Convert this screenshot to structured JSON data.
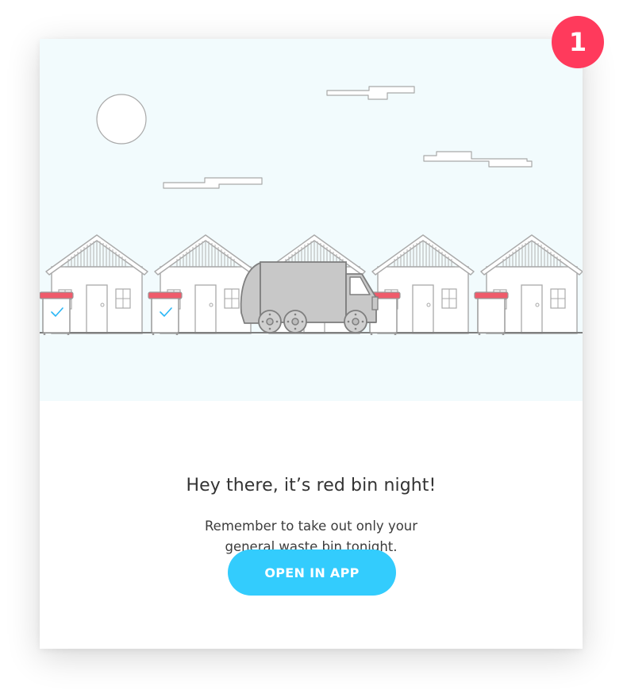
{
  "badge": {
    "count": "1"
  },
  "notification": {
    "headline": "Hey there, it’s red bin night!",
    "body_line_1": "Remember to take out only your",
    "body_line_2": "general waste bin tonight.",
    "button_label": "OPEN IN APP"
  },
  "colors": {
    "accent": "#33ccfd",
    "badge": "#ff3a5c",
    "bin_lid": "#ef5b6b",
    "sky": "#f2fbfd",
    "truck": "#c8c8c8",
    "checkmark": "#29b6f6"
  },
  "illustration": {
    "houses": 5,
    "bins": 5,
    "checked_bins": 2
  }
}
